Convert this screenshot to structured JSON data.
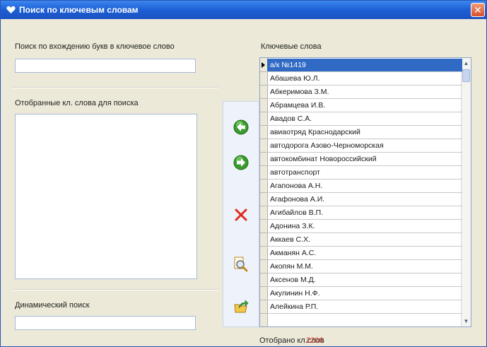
{
  "window": {
    "title": "Поиск по ключевым словам",
    "accent": "#1d5fd6",
    "close_glyph": "✕"
  },
  "left": {
    "search_label": "Поиск по вхождению букв в ключевое слово",
    "search_value": "",
    "selected_label": "Отобранные кл. слова для поиска",
    "selected_items": [],
    "dynamic_label": "Динамический поиск",
    "dynamic_value": ""
  },
  "toolbar": {
    "buttons": [
      {
        "name": "move-left-button",
        "icon": "arrow-left-icon"
      },
      {
        "name": "move-right-button",
        "icon": "arrow-right-icon"
      },
      {
        "name": "delete-button",
        "icon": "delete-icon"
      },
      {
        "name": "search-button",
        "icon": "magnifier-icon"
      },
      {
        "name": "export-button",
        "icon": "folder-arrow-icon"
      }
    ]
  },
  "keywords": {
    "label": "Ключевые слова",
    "selected_index": 0,
    "items": [
      "а/к №1419",
      "Абашева Ю.Л.",
      "Абкеримова З.М.",
      "Абрамцева И.В.",
      "Авадов С.А.",
      "авиаотряд Краснодарский",
      "автодорога Азово-Черноморская",
      "автокомбинат Новороссийский",
      "автотранспорт",
      "Агапонова А.Н.",
      "Агафонова А.И.",
      "Агибайлов В.П.",
      "Адонина З.К.",
      "Аккаев С.Х.",
      "Акманян А.С.",
      "Акопян М.М.",
      "Аксенов М.Д.",
      "Акулинин Н.Ф.",
      "Алейкина Р.П."
    ],
    "count_label": "Отобрано кл.слов",
    "count_value": "2206"
  }
}
